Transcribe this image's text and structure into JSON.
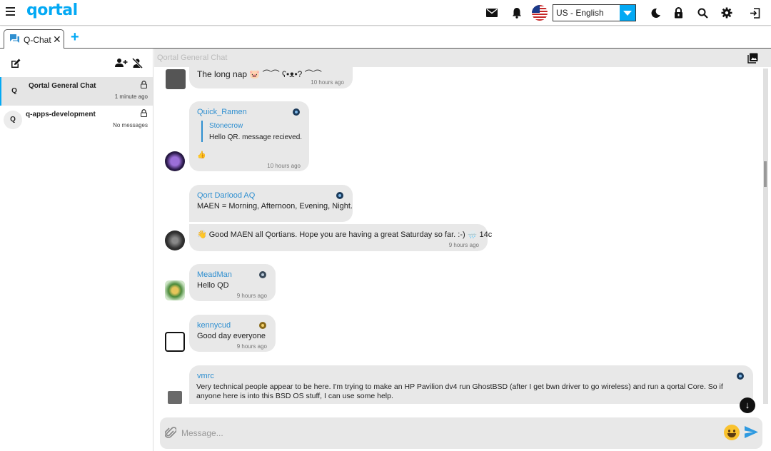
{
  "app": {
    "logo": "qortal",
    "language": "US - English"
  },
  "tabs": [
    {
      "label": "Q-Chat"
    }
  ],
  "sidebar": {
    "chats": [
      {
        "avatar_letter": "Q",
        "name": "Qortal General Chat",
        "time": "1 minute ago"
      },
      {
        "avatar_letter": "Q",
        "name": "q-apps-development",
        "time": "No messages"
      }
    ]
  },
  "chat": {
    "title": "Qortal General Chat",
    "messages": [
      {
        "user": "",
        "text": "The long nap 🐷  ⌒⌒ ʕ•ᴥ•? ⌒⌒",
        "time": "10 hours ago"
      },
      {
        "user": "Quick_Ramen",
        "quote_user": "Stonecrow",
        "quote_text": "Hello QR. message recieved.",
        "text": "👍",
        "time": "10 hours ago"
      },
      {
        "user": "Qort Darlood AQ",
        "text": "MAEN = Morning, Afternoon, Evening, Night.",
        "time": ""
      },
      {
        "user": "",
        "text": "👋 Good MAEN all Qortians. Hope you are having a great Saturday so far. :-) 🌧️ 14c",
        "time": "9 hours ago"
      },
      {
        "user": "MeadMan",
        "text": "Hello QD",
        "time": "9 hours ago"
      },
      {
        "user": "kennycud",
        "text": "Good day everyone",
        "time": "9 hours ago"
      },
      {
        "user": "vmrc",
        "text": "Very technical people appear to be here.  I'm trying to make an HP Pavilion dv4 run GhostBSD (after I get bwn driver to go wireless) and run a qortal Core.  So if",
        "text2": "anyone here is into this BSD OS stuff, I can use some help.",
        "time": ""
      }
    ]
  },
  "composer": {
    "placeholder": "Message..."
  }
}
